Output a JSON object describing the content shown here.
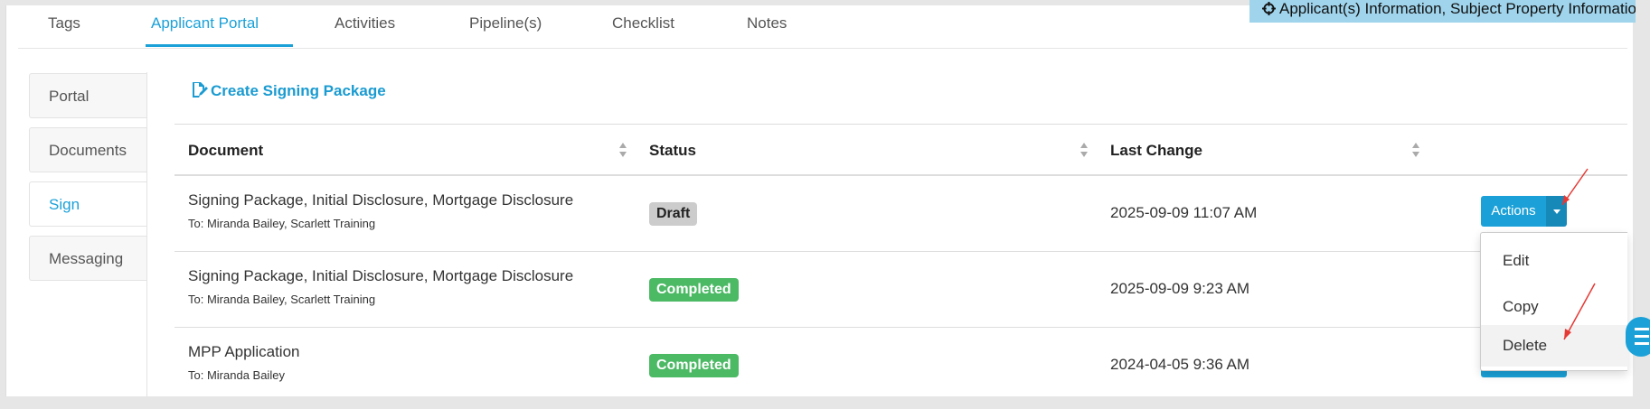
{
  "tabs": [
    "Tags",
    "Applicant Portal",
    "Activities",
    "Pipeline(s)",
    "Checklist",
    "Notes"
  ],
  "active_tab": "Applicant Portal",
  "banner": {
    "text": "Applicant(s) Information, Subject Property Information",
    "icon": "crosshair-icon"
  },
  "sidebar": {
    "items": [
      "Portal",
      "Documents",
      "Sign",
      "Messaging"
    ],
    "active": "Sign"
  },
  "create_link": {
    "label": "Create Signing Package",
    "icon": "edit-document-icon"
  },
  "table": {
    "columns": [
      "Document",
      "Status",
      "Last Change"
    ],
    "rows": [
      {
        "title": "Signing Package, Initial Disclosure, Mortgage Disclosure",
        "to": "To: Miranda Bailey, Scarlett Training",
        "status": "Draft",
        "last_change": "2025-09-09 11:07 AM"
      },
      {
        "title": "Signing Package, Initial Disclosure, Mortgage Disclosure",
        "to": "To: Miranda Bailey, Scarlett Training",
        "status": "Completed",
        "last_change": "2025-09-09 9:23 AM"
      },
      {
        "title": "MPP Application",
        "to": "To: Miranda Bailey",
        "status": "Completed",
        "last_change": "2024-04-05 9:36 AM"
      }
    ]
  },
  "actions_button": {
    "label": "Actions"
  },
  "actions_menu": {
    "items": [
      "Edit",
      "Copy",
      "Delete"
    ],
    "hovered": "Delete"
  },
  "colors": {
    "accent": "#1ba1d8",
    "completed": "#4cb965",
    "draft": "#cccccc",
    "annotation_arrow": "#e53935"
  }
}
